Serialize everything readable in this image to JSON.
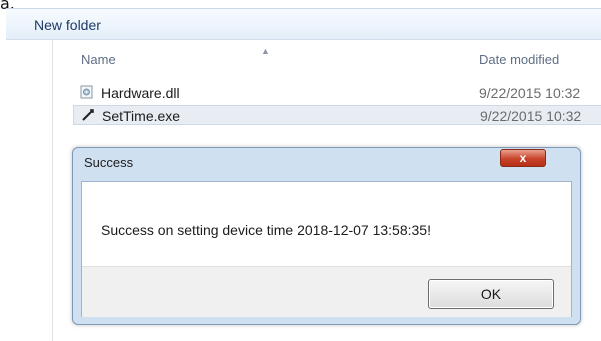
{
  "top_glyph": "a.",
  "breadcrumb": {
    "current_folder": "New folder"
  },
  "file_list": {
    "columns": {
      "name": "Name",
      "date_modified": "Date modified"
    },
    "rows": [
      {
        "name": "Hardware.dll",
        "date": "9/22/2015 10:32",
        "icon": "dll-file-icon",
        "selected": false
      },
      {
        "name": "SetTime.exe",
        "date": "9/22/2015 10:32",
        "icon": "exe-file-icon",
        "selected": true
      }
    ]
  },
  "dialog": {
    "title": "Success",
    "close_glyph": "x",
    "message": "Success on setting device time 2018-12-07 13:58:35!",
    "ok_label": "OK"
  },
  "colors": {
    "breadcrumb_text": "#1e3a64",
    "dialog_frame": "#cfe0f1",
    "close_button": "#c8442a"
  }
}
